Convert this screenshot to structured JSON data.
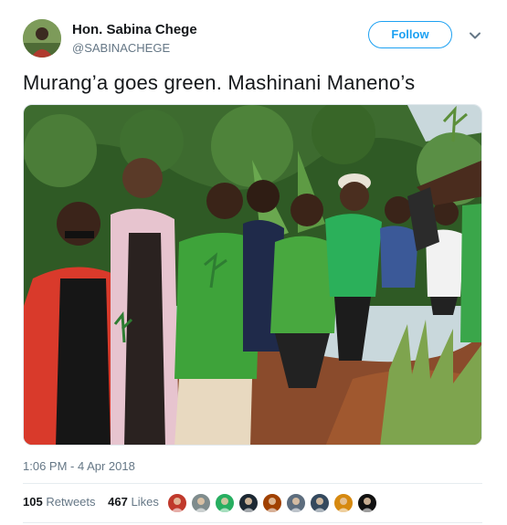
{
  "author": {
    "name": "Hon. Sabina Chege",
    "handle": "@SABINACHEGE"
  },
  "follow_label": "Follow",
  "tweet_text": "Murang’a goes green. Mashinani Maneno’s",
  "photo": {
    "alt": "Women in green jackets planting tree seedlings on a hillside"
  },
  "timestamp": "1:06 PM - 4 Apr 2018",
  "stats": {
    "retweets": "105",
    "retweets_label": "Retweets",
    "likes": "467",
    "likes_label": "Likes"
  },
  "liker_avatars": [
    {
      "color": "#c0392b",
      "icon": "avatar-1"
    },
    {
      "color": "#7f8c8d",
      "icon": "avatar-2"
    },
    {
      "color": "#27ae60",
      "icon": "avatar-3"
    },
    {
      "color": "#1c2833",
      "icon": "avatar-4"
    },
    {
      "color": "#a04000",
      "icon": "avatar-5"
    },
    {
      "color": "#5d6d7e",
      "icon": "avatar-6"
    },
    {
      "color": "#34495e",
      "icon": "avatar-7"
    },
    {
      "color": "#d68910",
      "icon": "avatar-8"
    },
    {
      "color": "#111111",
      "icon": "avatar-9"
    }
  ],
  "colors": {
    "accent": "#1da1f2",
    "secondary_text": "#657786",
    "primary_text": "#14171a"
  }
}
